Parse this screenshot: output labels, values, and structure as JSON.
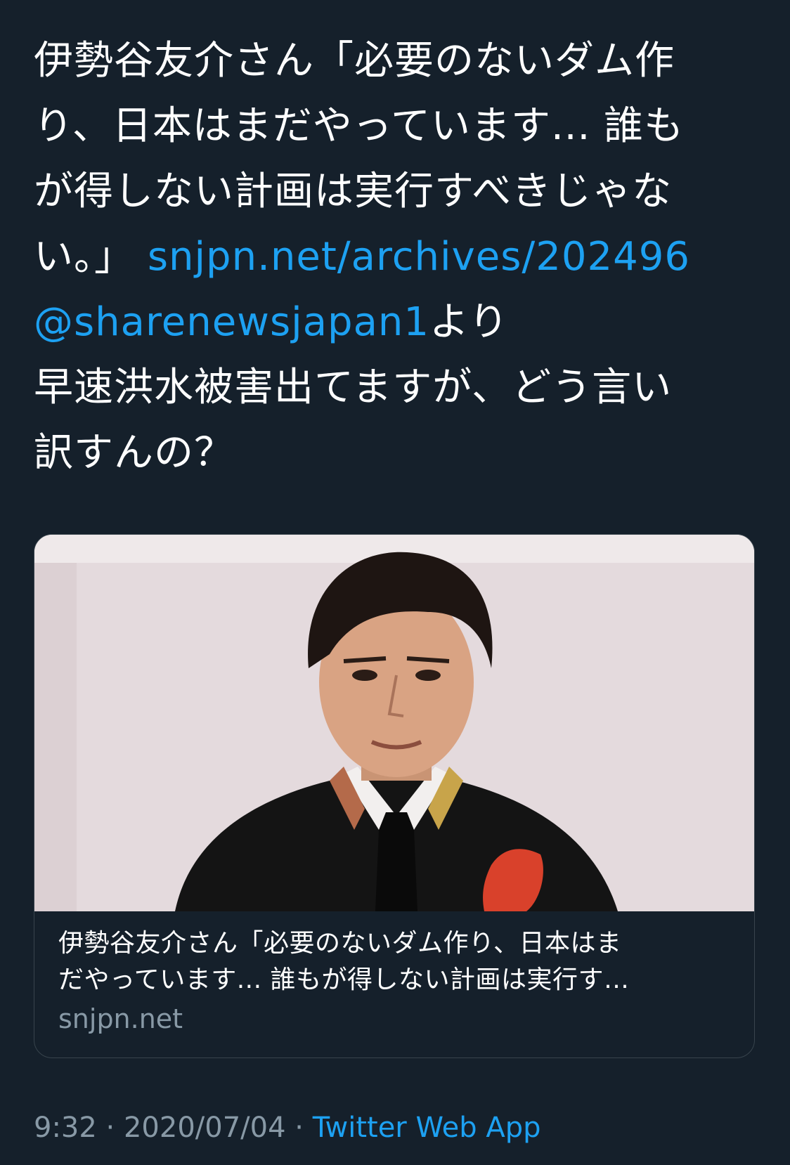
{
  "tweet": {
    "lines": [
      "伊勢谷友介さん「必要のないダム作",
      "り、日本はまだやっています... 誰も",
      "が得しない計画は実行すべきじゃな",
      "い。」"
    ],
    "link_text": "snjpn.net/archives/202496",
    "mention": "@sharenewsjapan1",
    "mention_suffix": "より",
    "reply_lines": [
      "早速洪水被害出てますが、どう言い",
      "訳すんの？"
    ]
  },
  "card": {
    "title_lines": [
      "伊勢谷友介さん「必要のないダム作り、日本はま",
      "だやっています... 誰もが得しない計画は実行す…"
    ],
    "domain": "snjpn.net",
    "image_icon": "portrait-photo"
  },
  "meta": {
    "time": "9:32",
    "separator": "·",
    "date": "2020/07/04",
    "source": "Twitter Web App"
  },
  "colors": {
    "background": "#15202b",
    "link": "#1da1f2",
    "muted": "#8899a6",
    "border": "#38444d"
  }
}
